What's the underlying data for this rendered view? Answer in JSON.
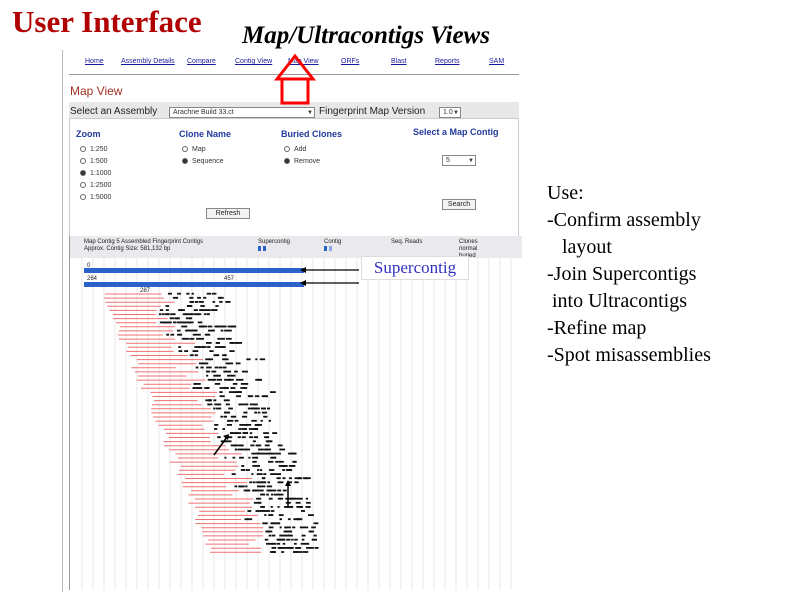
{
  "slide": {
    "title": "User Interface",
    "subtitle": "Map/Ultracontigs Views",
    "callout": "Supercontig",
    "use_lines": [
      "Use:",
      "-Confirm assembly",
      "   layout",
      "-Join Supercontigs",
      " into Ultracontigs",
      "-Refine map",
      "-Spot misassemblies"
    ]
  },
  "app": {
    "nav": [
      "Home",
      "Assembly Details",
      "Compare",
      "Contig View",
      "Map View",
      "ORFs",
      "Blast",
      "Reports",
      "SAM"
    ],
    "active_nav": "Map View",
    "page_title": "Map View",
    "assembly_label": "Select an Assembly",
    "assembly_value": "Arachne Build 33.ct",
    "fingerprint_label": "Fingerprint Map Version",
    "fingerprint_value": "1.0",
    "zoom": {
      "label": "Zoom",
      "options": [
        "1:250",
        "1:500",
        "1:1000",
        "1:2500",
        "1:5000"
      ],
      "selected": "1:1000"
    },
    "clone_name": {
      "label": "Clone Name",
      "options": [
        "Map",
        "Sequence"
      ],
      "selected": "Sequence"
    },
    "buried_clones": {
      "label": "Buried Clones",
      "options": [
        "Add",
        "Remove"
      ],
      "selected": "Remove"
    },
    "map_contig": {
      "label": "Select a Map Contig",
      "value": "5"
    },
    "refresh_label": "Refresh",
    "search_label": "Search",
    "map_header": {
      "contig_line1": "Map Contig 5 Assembled Fingerprint Contigs",
      "contig_line2": "Approx. Contig Size: 581,132 bp",
      "supercontig_col": "Supercontig",
      "contig_col": "Contig",
      "seq_reads_col": "Seq. Reads",
      "clones_col": "Clones",
      "clones_1": "normal",
      "clones_2": "buried",
      "marker_left": "0",
      "coord_1": "264",
      "coord_2": "457",
      "coord_3": "287"
    },
    "colors": {
      "supercontig_bar": "#2a62c9",
      "clone_line": "#f07070",
      "accent": "#a03020",
      "link": "#1a1aa0",
      "highlight_arrow": "#ff0000"
    }
  }
}
